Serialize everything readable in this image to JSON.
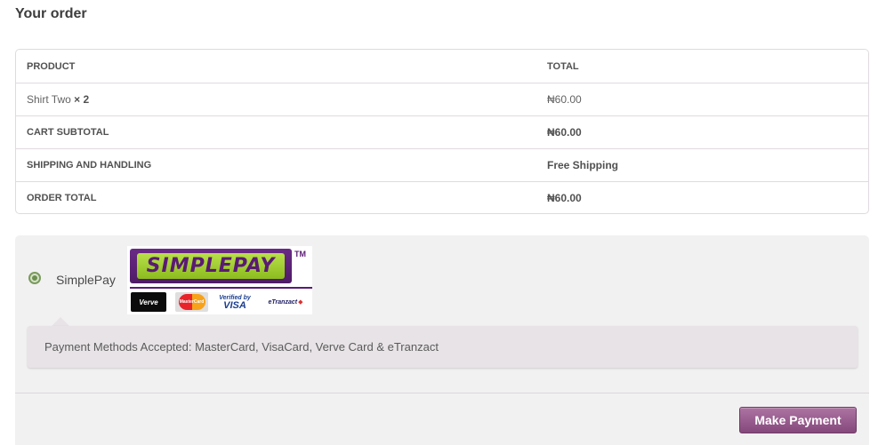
{
  "page": {
    "heading": "Your order"
  },
  "order_table": {
    "headers": {
      "product": "PRODUCT",
      "total": "TOTAL"
    },
    "item": {
      "name": "Shirt Two",
      "qty": "× 2",
      "total": "₦60.00"
    },
    "subtotal": {
      "label": "CART SUBTOTAL",
      "value": "₦60.00"
    },
    "shipping": {
      "label": "SHIPPING AND HANDLING",
      "value": "Free Shipping"
    },
    "order_total": {
      "label": "ORDER TOTAL",
      "value": "₦60.00"
    }
  },
  "payment": {
    "method_label": "SimplePay",
    "method_selected": true,
    "logo": {
      "brand": "SIMPLEPAY",
      "tm": "TM",
      "cards": {
        "verve": "Verve",
        "mastercard": "MasterCard",
        "visa_line1": "Verified by",
        "visa_line2": "VISA",
        "etranzact": "eTranzact"
      }
    },
    "description": "Payment Methods Accepted: MasterCard, VisaCard, Verve Card & eTranzact",
    "button_label": "Make Payment"
  },
  "colors": {
    "accent_button": "#85487c",
    "radio": "#6d8f50"
  }
}
